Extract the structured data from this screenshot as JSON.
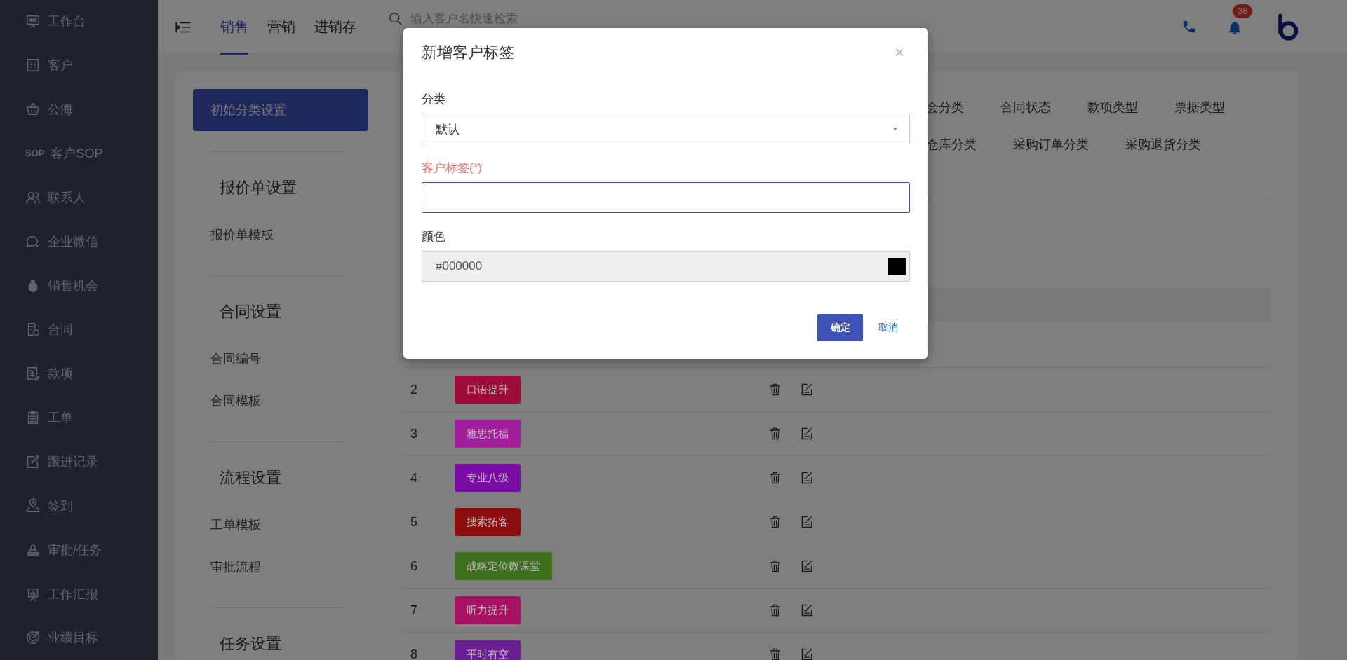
{
  "sidebar": {
    "items": [
      {
        "label": "工作台"
      },
      {
        "label": "客户"
      },
      {
        "label": "公海"
      },
      {
        "label": "客户SOP",
        "icon_text": "SOP"
      },
      {
        "label": "联系人"
      },
      {
        "label": "企业微信"
      },
      {
        "label": "销售机会"
      },
      {
        "label": "合同"
      },
      {
        "label": "款项"
      },
      {
        "label": "工单"
      },
      {
        "label": "跟进记录"
      },
      {
        "label": "签到"
      },
      {
        "label": "审批/任务"
      },
      {
        "label": "工作汇报"
      },
      {
        "label": "业绩目标"
      }
    ]
  },
  "topbar": {
    "tabs": [
      {
        "label": "销售",
        "selected": true
      },
      {
        "label": "营销",
        "selected": false
      },
      {
        "label": "进销存",
        "selected": false
      }
    ],
    "search": {
      "placeholder": "输入客户名快速检索"
    },
    "notifications": {
      "badge": "36"
    }
  },
  "settings_nav": {
    "top_item": {
      "label": "初始分类设置",
      "selected": true
    },
    "sections": [
      {
        "title": "报价单设置",
        "items": [
          "报价单模板"
        ]
      },
      {
        "title": "合同设置",
        "items": [
          "合同编号",
          "合同模板"
        ]
      },
      {
        "title": "流程设置",
        "items": [
          "工单模板",
          "审批流程"
        ]
      },
      {
        "title": "任务设置"
      }
    ]
  },
  "category_tabs": {
    "tabs": [
      "会分类",
      "合同状态",
      "款项类型",
      "票据类型",
      "仓库分类",
      "采购订单分类",
      "采购退货分类"
    ]
  },
  "tags_table": {
    "rows": [
      {
        "index": "2",
        "tag": "口语提升",
        "color": "#9c0c36"
      },
      {
        "index": "3",
        "tag": "雅思托福",
        "color": "#a21e9c"
      },
      {
        "index": "4",
        "tag": "专业八级",
        "color": "#7a0ca6"
      },
      {
        "index": "5",
        "tag": "搜索拓客",
        "color": "#8c0e0e"
      },
      {
        "index": "6",
        "tag": "战略定位微课堂",
        "color": "#3c6e1e"
      },
      {
        "index": "7",
        "tag": "听力提升",
        "color": "#a81062"
      },
      {
        "index": "8",
        "tag": "平时有空",
        "color": "#6a2092"
      }
    ]
  },
  "dialog": {
    "title": "新增客户标签",
    "close": "×",
    "fields": [
      {
        "kind": "select",
        "label": "分类",
        "value": "默认",
        "required": false
      },
      {
        "kind": "text",
        "label": "客户标签(*)",
        "required": true
      },
      {
        "kind": "color",
        "label": "颜色",
        "value": "#000000",
        "color": "#000000",
        "required": false
      }
    ],
    "buttons": [
      {
        "kind": "primary",
        "label": "确定"
      },
      {
        "kind": "link",
        "label": "取消"
      }
    ]
  }
}
